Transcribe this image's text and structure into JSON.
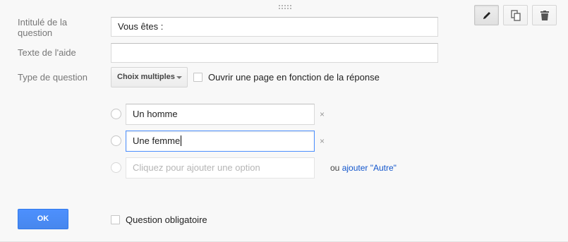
{
  "question": {
    "title_label": "Intitulé de la question",
    "title_value": "Vous êtes :",
    "help_label": "Texte de l'aide",
    "help_value": "",
    "type_label": "Type de question",
    "type_selected": "Choix multiples",
    "page_branch_label": "Ouvrir une page en fonction de la réponse",
    "page_branch_checked": false
  },
  "options": [
    {
      "value": "Un homme",
      "remove": "×"
    },
    {
      "value": "Une femme",
      "remove": "×"
    }
  ],
  "add_option": {
    "placeholder": "Cliquez pour ajouter une option",
    "or_text": "ou ",
    "other_link": "ajouter \"Autre\""
  },
  "footer": {
    "ok_label": "OK",
    "required_label": "Question obligatoire",
    "required_checked": false
  },
  "toolbar": {
    "icons": [
      "pencil-icon",
      "duplicate-icon",
      "trash-icon"
    ],
    "active": "pencil-icon"
  }
}
